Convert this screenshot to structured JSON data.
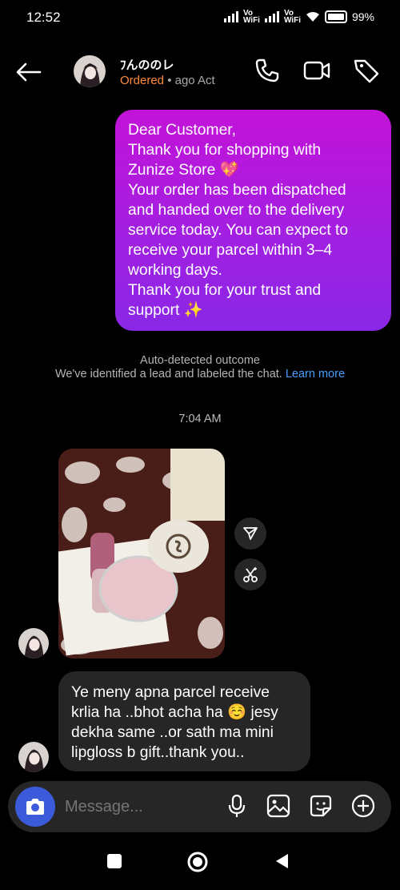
{
  "status_bar": {
    "time": "12:52",
    "battery": "99%",
    "vowifi_1": "Vo\nWiFi",
    "vowifi_2": "Vo\nWiFi"
  },
  "header": {
    "contact_name": "ﾌんののレ",
    "status": "Ordered",
    "last_active": "• ago  Act"
  },
  "messages": {
    "outgoing_text": "Dear Customer,\nThank you for shopping with\nZunize Store 💖\nYour order has been dispatched\nand handed over to the delivery\nservice today. You can expect to\nreceive your parcel within 3–4\nworking days.\nThank you for your trust and\nsupport ✨",
    "auto_title": "Auto-detected outcome",
    "auto_text": "We've identified a lead and labeled the chat.",
    "learn_more": "Learn more",
    "timestamp": "7:04 AM",
    "incoming_text": "Ye  meny apna parcel receive\nkrlia ha ..bhot acha ha ☺️ jesy\ndekha same ..or sath ma mini\nlipgloss b gift..thank you.."
  },
  "composer": {
    "placeholder": "Message..."
  },
  "colors": {
    "bubble_start": "#c313d8",
    "bubble_end": "#8a27e6",
    "link": "#4a9dff",
    "status_orange": "#ff8a3d"
  }
}
